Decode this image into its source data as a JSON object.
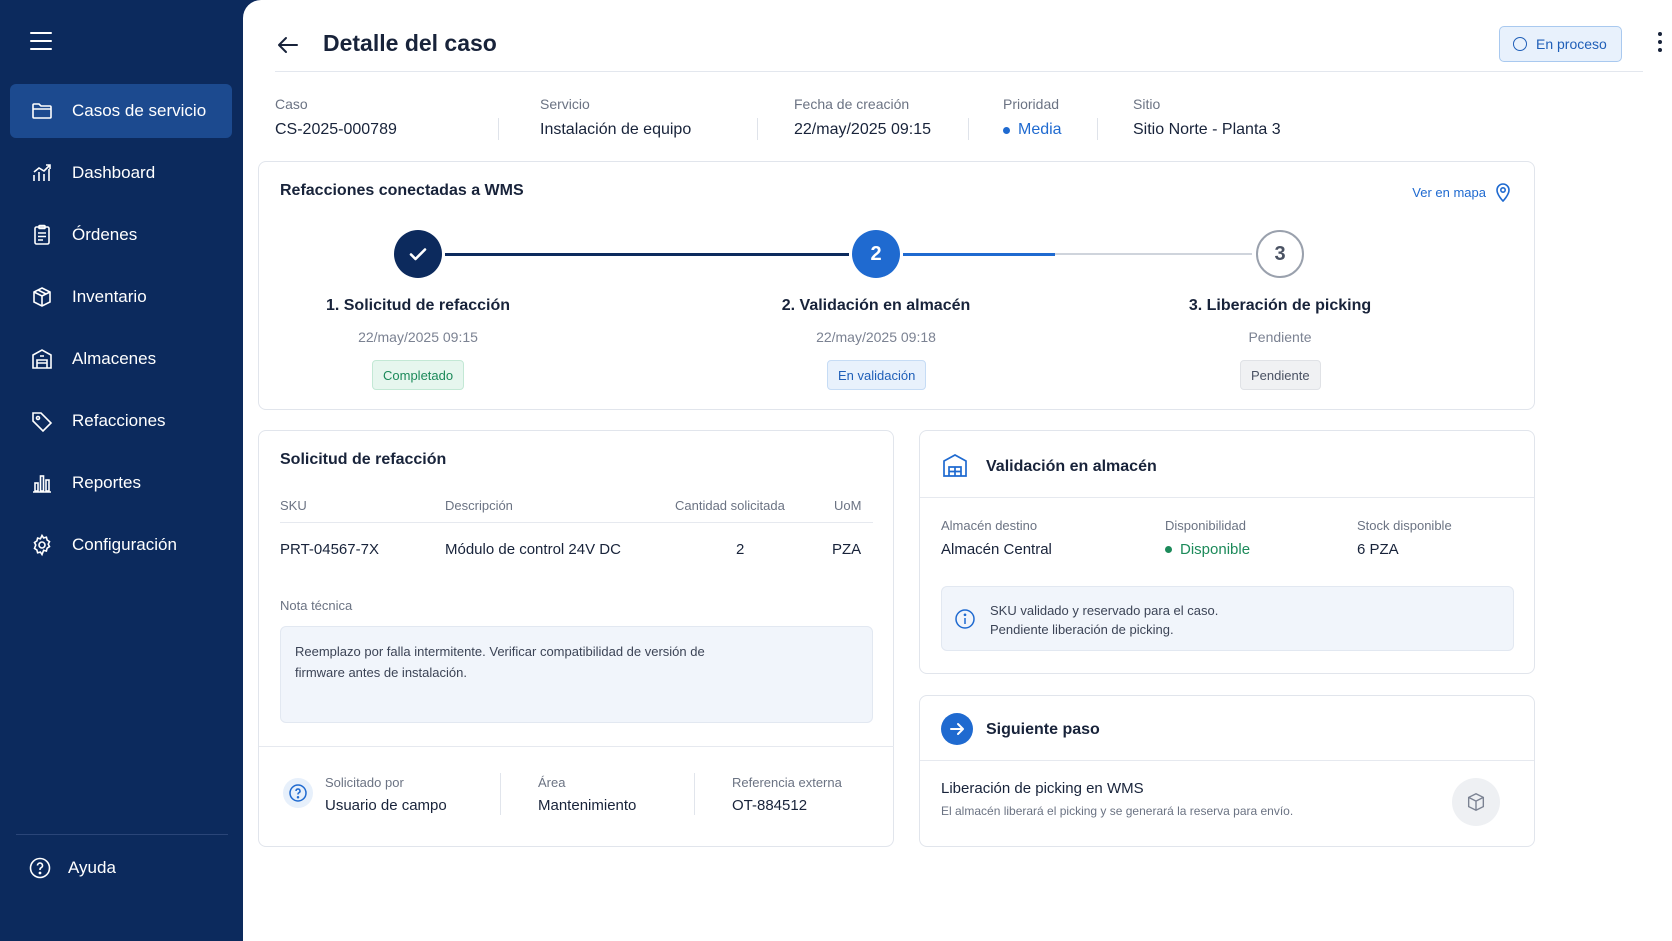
{
  "sidebar": {
    "items": [
      {
        "label": "Casos de servicio",
        "icon": "folder-icon",
        "active": true
      },
      {
        "label": "Dashboard",
        "icon": "chart-icon"
      },
      {
        "label": "Órdenes",
        "icon": "clipboard-icon"
      },
      {
        "label": "Inventario",
        "icon": "box-icon"
      },
      {
        "label": "Almacenes",
        "icon": "building-icon"
      },
      {
        "label": "Refacciones",
        "icon": "tag-icon"
      },
      {
        "label": "Reportes",
        "icon": "bar-chart-icon"
      },
      {
        "label": "Configuración",
        "icon": "gear-icon"
      }
    ],
    "help_label": "Ayuda"
  },
  "header": {
    "title": "Detalle del caso",
    "status": "En proceso"
  },
  "meta": {
    "case_label": "Caso",
    "case_value": "CS-2025-000789",
    "service_label": "Servicio",
    "service_value": "Instalación de equipo",
    "created_label": "Fecha de creación",
    "created_value": "22/may/2025 09:15",
    "priority_label": "Prioridad",
    "priority_value": "Media",
    "site_label": "Sitio",
    "site_value": "Sitio Norte - Planta 3"
  },
  "wms": {
    "title": "Refacciones conectadas a WMS",
    "map_link": "Ver en mapa",
    "steps": [
      {
        "number": "1",
        "title": "1. Solicitud de refacción",
        "date": "22/may/2025 09:15",
        "badge": "Completado",
        "state": "done"
      },
      {
        "number": "2",
        "title": "2. Validación en almacén",
        "date": "22/may/2025 09:18",
        "badge": "En validación",
        "state": "current"
      },
      {
        "number": "3",
        "title": "3. Liberación de picking",
        "date": "Pendiente",
        "badge": "Pendiente",
        "state": "pending"
      }
    ]
  },
  "request": {
    "title": "Solicitud de refacción",
    "columns": [
      "SKU",
      "Descripción",
      "Cantidad solicitada",
      "UoM"
    ],
    "row": {
      "sku": "PRT-04567-7X",
      "description": "Módulo de control 24V DC",
      "qty": "2",
      "uom": "PZA"
    },
    "note_label": "Nota técnica",
    "note_text": "Reemplazo por falla intermitente. Verificar compatibilidad de versión de firmware antes de instalación.",
    "requested_by_label": "Solicitado por",
    "requested_by_value": "Usuario de campo",
    "area_label": "Área",
    "area_value": "Mantenimiento",
    "ext_ref_label": "Referencia externa",
    "ext_ref_value": "OT-884512"
  },
  "validation": {
    "title": "Validación en almacén",
    "dest_label": "Almacén destino",
    "dest_value": "Almacén Central",
    "avail_label": "Disponibilidad",
    "avail_value": "Disponible",
    "stock_label": "Stock disponible",
    "stock_value": "6 PZA",
    "info_line1": "SKU validado y reservado para el caso.",
    "info_line2": "Pendiente liberación de picking."
  },
  "next": {
    "title": "Siguiente paso",
    "heading": "Liberación de picking en WMS",
    "description": "El almacén liberará el picking y se generará la reserva para envío."
  },
  "colors": {
    "sidebar_bg": "#0c2a5d",
    "accent": "#1f6ad0",
    "success": "#1c8a5a",
    "done_step": "#0c2a5d"
  }
}
